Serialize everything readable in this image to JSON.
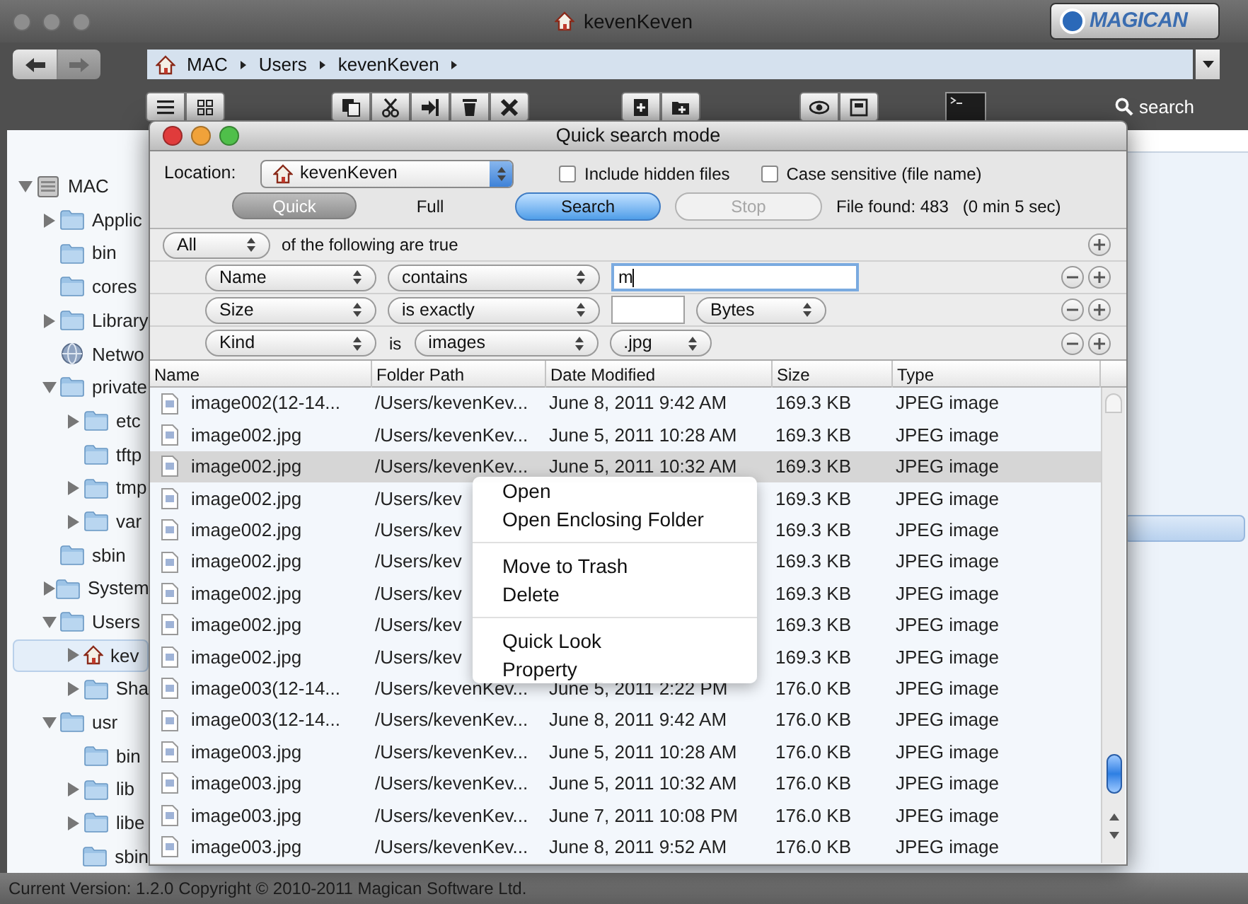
{
  "window": {
    "title": "kevenKeven",
    "logo": "MAGICAN"
  },
  "path_bar": {
    "segments": [
      "MAC",
      "Users",
      "kevenKeven"
    ]
  },
  "toolbar": {
    "search_label": "search"
  },
  "sidebar": {
    "tree": [
      {
        "label": "MAC",
        "kind": "disk",
        "expanded": true,
        "selected": false,
        "children": [
          {
            "label": "Applic",
            "kind": "folder",
            "expanded": false,
            "selected": false
          },
          {
            "label": "bin",
            "kind": "folder",
            "selected": false
          },
          {
            "label": "cores",
            "kind": "folder",
            "selected": false
          },
          {
            "label": "Library",
            "kind": "folder",
            "expanded": false,
            "selected": false
          },
          {
            "label": "Netwo",
            "kind": "globe",
            "selected": false
          },
          {
            "label": "private",
            "kind": "folder",
            "expanded": true,
            "selected": false,
            "children": [
              {
                "label": "etc",
                "kind": "folder",
                "expanded": false,
                "selected": false
              },
              {
                "label": "tftp",
                "kind": "folder",
                "selected": false
              },
              {
                "label": "tmp",
                "kind": "folder",
                "expanded": false,
                "selected": false
              },
              {
                "label": "var",
                "kind": "folder",
                "expanded": false,
                "selected": false
              }
            ]
          },
          {
            "label": "sbin",
            "kind": "folder",
            "selected": false
          },
          {
            "label": "System",
            "kind": "folder",
            "expanded": false,
            "selected": false
          },
          {
            "label": "Users",
            "kind": "folder",
            "expanded": true,
            "selected": false,
            "children": [
              {
                "label": "kev",
                "kind": "home",
                "expanded": false,
                "selected": true
              },
              {
                "label": "Sha",
                "kind": "folder",
                "expanded": false,
                "selected": false
              }
            ]
          },
          {
            "label": "usr",
            "kind": "folder",
            "expanded": true,
            "selected": false,
            "children": [
              {
                "label": "bin",
                "kind": "folder",
                "selected": false
              },
              {
                "label": "lib",
                "kind": "folder",
                "expanded": false,
                "selected": false
              },
              {
                "label": "libe",
                "kind": "folder",
                "expanded": false,
                "selected": false
              },
              {
                "label": "sbin",
                "kind": "folder",
                "selected": false
              }
            ]
          }
        ]
      }
    ]
  },
  "dialog": {
    "title": "Quick search mode",
    "location": {
      "label": "Location:",
      "value": "kevenKeven"
    },
    "checkboxes": [
      {
        "label": "Include hidden files",
        "checked": false
      },
      {
        "label": "Case sensitive (file name)",
        "checked": false
      }
    ],
    "modes": [
      {
        "label": "Quick",
        "selected": true
      },
      {
        "label": "Full",
        "selected": false
      }
    ],
    "search_button": {
      "label": "Search",
      "disabled": false
    },
    "stop_button": {
      "label": "Stop",
      "disabled": true
    },
    "found": "File found: 483",
    "elapsed": "(0 min 5 sec)",
    "match": {
      "value": "All",
      "text": "of the following are true"
    },
    "criteria": [
      {
        "parts": [
          {
            "kind": "popup",
            "value": "Name"
          },
          {
            "kind": "popup",
            "value": "contains"
          },
          {
            "kind": "field",
            "value": "m",
            "focused": true
          }
        ]
      },
      {
        "parts": [
          {
            "kind": "popup",
            "value": "Size"
          },
          {
            "kind": "popup",
            "value": "is exactly"
          },
          {
            "kind": "field",
            "focused": false
          },
          {
            "kind": "popup",
            "value": "Bytes"
          }
        ]
      },
      {
        "parts": [
          {
            "kind": "popup",
            "value": "Kind"
          },
          {
            "kind": "text",
            "value": "is"
          },
          {
            "kind": "popup",
            "value": "images"
          },
          {
            "kind": "popup",
            "value": ".jpg"
          }
        ]
      }
    ],
    "table": {
      "columns": [
        "Name",
        "Folder Path",
        "Date Modified",
        "Size",
        "Type"
      ],
      "rows": [
        {
          "name": "image002(12-14...",
          "folder_path": "/Users/kevenKev...",
          "date_modified": "June 8, 2011 9:42 AM",
          "size": "169.3 KB",
          "type": "JPEG image",
          "selected": false
        },
        {
          "name": "image002.jpg",
          "folder_path": "/Users/kevenKev...",
          "date_modified": "June 5, 2011 10:28 AM",
          "size": "169.3 KB",
          "type": "JPEG image",
          "selected": false
        },
        {
          "name": "image002.jpg",
          "folder_path": "/Users/kevenKev...",
          "date_modified": "June 5, 2011 10:32 AM",
          "size": "169.3 KB",
          "type": "JPEG image",
          "selected": true
        },
        {
          "name": "image002.jpg",
          "folder_path": "/Users/kev",
          "size": "169.3 KB",
          "type": "JPEG image",
          "selected": false
        },
        {
          "name": "image002.jpg",
          "folder_path": "/Users/kev",
          "size": "169.3 KB",
          "type": "JPEG image",
          "selected": false
        },
        {
          "name": "image002.jpg",
          "folder_path": "/Users/kev",
          "size": "169.3 KB",
          "type": "JPEG image",
          "selected": false
        },
        {
          "name": "image002.jpg",
          "folder_path": "/Users/kev",
          "size": "169.3 KB",
          "type": "JPEG image",
          "selected": false
        },
        {
          "name": "image002.jpg",
          "folder_path": "/Users/kev",
          "size": "169.3 KB",
          "type": "JPEG image",
          "selected": false
        },
        {
          "name": "image002.jpg",
          "folder_path": "/Users/kev",
          "size": "169.3 KB",
          "type": "JPEG image",
          "selected": false
        },
        {
          "name": "image003(12-14...",
          "folder_path": "/Users/kevenKev...",
          "date_modified": "June 5, 2011 2:22 PM",
          "size": "176.0 KB",
          "type": "JPEG image",
          "selected": false
        },
        {
          "name": "image003(12-14...",
          "folder_path": "/Users/kevenKev...",
          "date_modified": "June 8, 2011 9:42 AM",
          "size": "176.0 KB",
          "type": "JPEG image",
          "selected": false
        },
        {
          "name": "image003.jpg",
          "folder_path": "/Users/kevenKev...",
          "date_modified": "June 5, 2011 10:28 AM",
          "size": "176.0 KB",
          "type": "JPEG image",
          "selected": false
        },
        {
          "name": "image003.jpg",
          "folder_path": "/Users/kevenKev...",
          "date_modified": "June 5, 2011 10:32 AM",
          "size": "176.0 KB",
          "type": "JPEG image",
          "selected": false
        },
        {
          "name": "image003.jpg",
          "folder_path": "/Users/kevenKev...",
          "date_modified": "June 7, 2011 10:08 PM",
          "size": "176.0 KB",
          "type": "JPEG image",
          "selected": false
        },
        {
          "name": "image003.jpg",
          "folder_path": "/Users/kevenKev...",
          "date_modified": "June 8, 2011 9:52 AM",
          "size": "176.0 KB",
          "type": "JPEG image",
          "selected": false
        }
      ]
    }
  },
  "context_menu": {
    "groups": [
      [
        "Open",
        "Open Enclosing Folder"
      ],
      [
        "Move to Trash",
        "Delete"
      ],
      [
        "Quick Look",
        "Property"
      ]
    ]
  },
  "status_bar": "Current Version: 1.2.0 Copyright © 2010-2011 Magican Software Ltd."
}
